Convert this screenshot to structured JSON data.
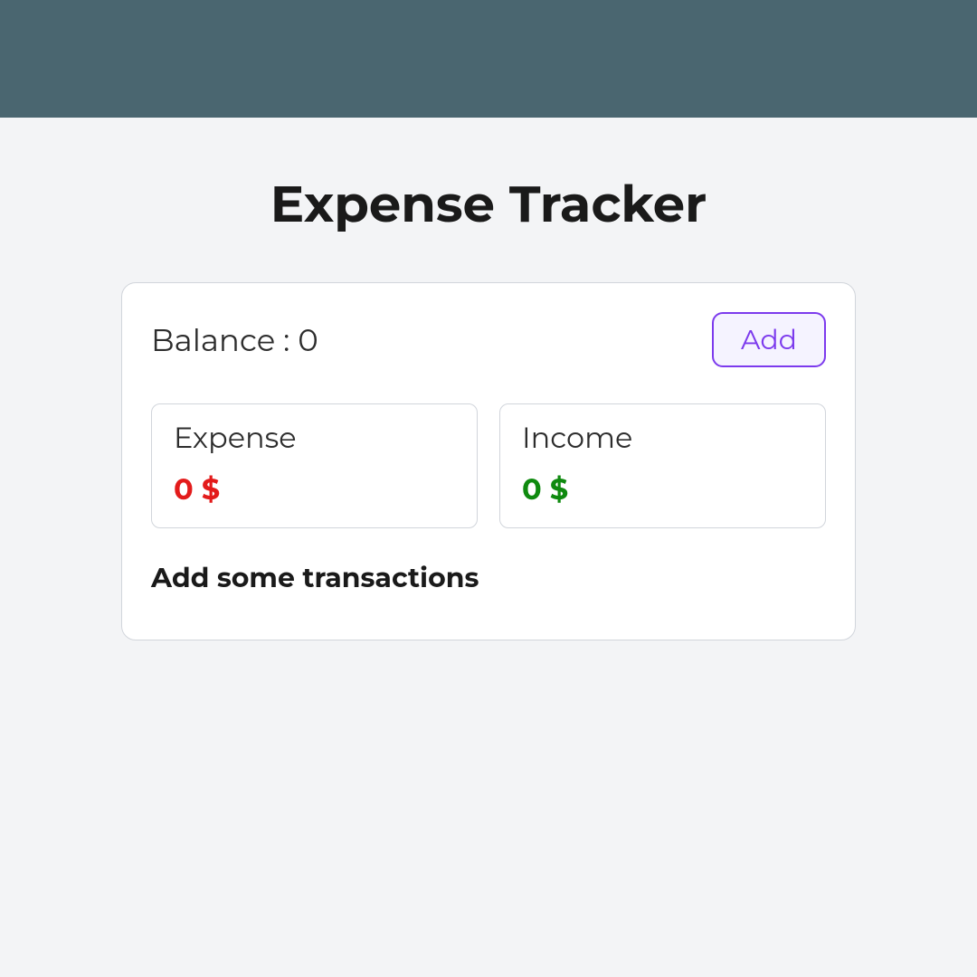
{
  "header": {
    "title": "Expense Tracker"
  },
  "balance": {
    "label": "Balance : 0"
  },
  "actions": {
    "add_label": "Add"
  },
  "summary": {
    "expense": {
      "label": "Expense",
      "value": "0 $"
    },
    "income": {
      "label": "Income",
      "value": "0 $"
    }
  },
  "transactions": {
    "empty_message": "Add some transactions"
  }
}
